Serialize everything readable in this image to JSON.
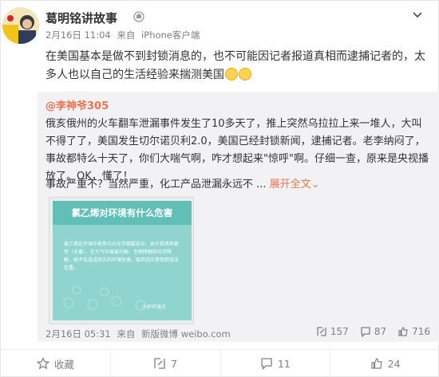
{
  "post": {
    "author": "葛明铭讲故事",
    "meta": [
      "2月16日 11:04",
      "来自",
      "iPhone客户端"
    ],
    "text_main": "在美国基本是做不到封锁消息的，也不可能因记者报道真相而逮捕记者的，太多人也以自己的生活经验来揣测美国"
  },
  "repost": {
    "user": "@李神爷305",
    "text": "俄亥俄州的火车翻车泄漏事件发生了10多天了，推上突然乌拉拉上来一堆人，大叫不得了了，美国发生切尔诺贝利2.0，美国已经封锁新闻，逮捕记者。老李纳闷了，事故都特么十天了，你们大喘气啊，咋才想起来\"惊呼\"啊。仔细一查，原来是央视播放了。OK，懂了！",
    "text2": "事故严重不？当然严重，化工产品泄漏永远不 ...",
    "expand": "展开全文",
    "expand_suffix": "⌄",
    "image": {
      "title": "氯乙烯对环境有什么危害",
      "body": "氯乙烯在环境中能参与光化学烟雾反应，由于其具有致性（无毒），在大气中易被光解、生物降解和化学降解，故不会造成持久的环境危害。废弃后应使用焚烧法处置。",
      "logo": "小护环境点"
    },
    "footer": [
      "2月16日 05:31",
      "来自",
      "新版微博 weibo.com"
    ],
    "stats": {
      "reposts": "157",
      "comments": "87",
      "likes": "716"
    }
  },
  "actions": {
    "favorite": "收藏",
    "repost": "7",
    "comment": "11",
    "like": "24"
  },
  "colors": {
    "accent": "#eb7350",
    "repost_bg": "#f2f2f5",
    "image_bg": "#8fd4cf"
  }
}
